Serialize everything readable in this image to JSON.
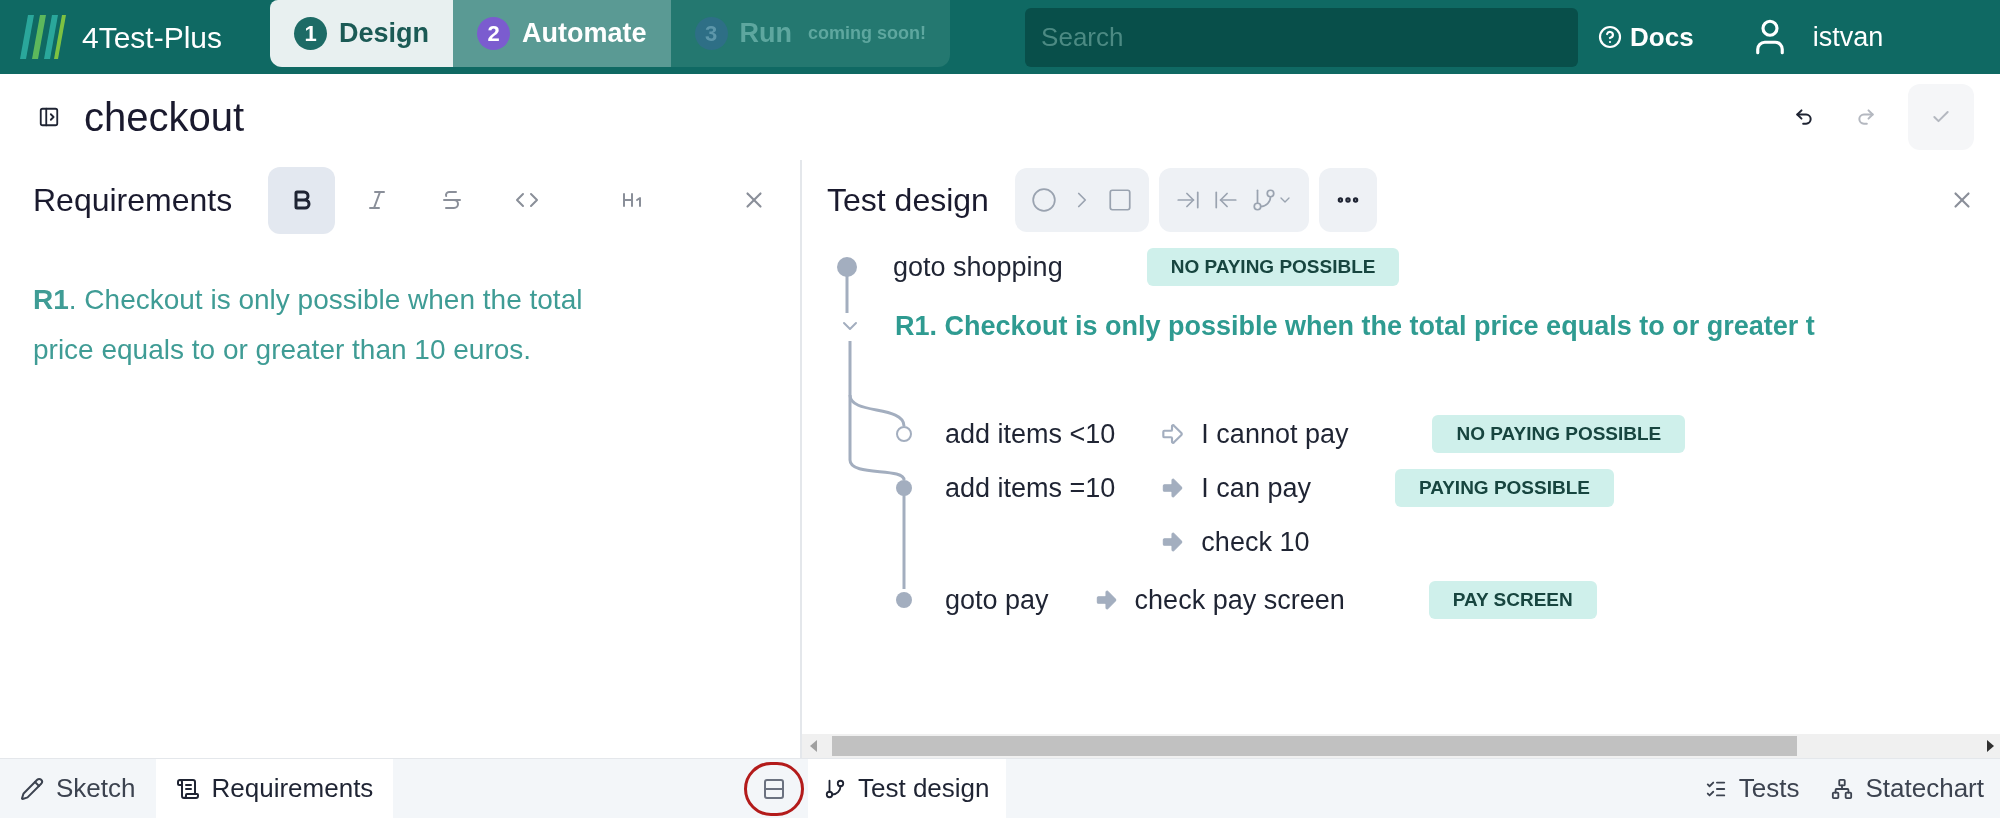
{
  "app": {
    "name": "4Test-Plus"
  },
  "stages": [
    {
      "number": "1",
      "label": "Design",
      "selected": true,
      "disabled": false
    },
    {
      "number": "2",
      "label": "Automate",
      "selected": false,
      "disabled": false
    },
    {
      "number": "3",
      "label": "Run",
      "note": "coming soon!",
      "selected": false,
      "disabled": true
    }
  ],
  "search": {
    "placeholder": "Search"
  },
  "docs_link": "Docs",
  "user": {
    "name": "istvan"
  },
  "page": {
    "title": "checkout"
  },
  "page_actions": [
    {
      "kind": "undo",
      "disabled": false
    },
    {
      "kind": "redo",
      "disabled": true
    },
    {
      "kind": "save",
      "disabled": true
    }
  ],
  "requirements_panel": {
    "title": "Requirements",
    "format_buttons": [
      {
        "kind": "bold",
        "selected": true
      },
      {
        "kind": "italic",
        "selected": false
      },
      {
        "kind": "strike",
        "selected": false
      },
      {
        "kind": "code",
        "selected": false
      },
      {
        "kind": "heading",
        "selected": false
      }
    ],
    "text": "**R1**. Checkout is only possible when the total price equals to or greater than 10 euros."
  },
  "test_design_panel": {
    "title": "Test design",
    "tree": [
      {
        "kind": "step",
        "label": "goto shopping",
        "reached": true,
        "badge": "NO PAYING POSSIBLE"
      },
      {
        "kind": "requirement",
        "text": "R1. Checkout is only possible when the total price equals to or greater t",
        "expanded": true,
        "children": [
          {
            "kind": "step",
            "label": "add items <10",
            "reached": false,
            "outcomes": [
              {
                "kind": "hollow",
                "text": "I cannot pay",
                "badge": "NO PAYING POSSIBLE"
              }
            ]
          },
          {
            "kind": "step",
            "label": "add items =10",
            "reached": true,
            "outcomes": [
              {
                "kind": "solid",
                "text": "I can pay",
                "badge": "PAYING POSSIBLE"
              },
              {
                "kind": "solid",
                "text": "check 10"
              }
            ]
          }
        ]
      },
      {
        "kind": "step",
        "label": "goto pay",
        "reached": true,
        "outcomes": [
          {
            "kind": "solid",
            "text": "check pay screen",
            "badge": "PAY SCREEN"
          }
        ]
      }
    ]
  },
  "bottom_left_tabs": [
    {
      "kind": "sketch",
      "label": "Sketch",
      "selected": false
    },
    {
      "kind": "requirements",
      "label": "Requirements",
      "selected": true
    }
  ],
  "bottom_right_tabs": [
    {
      "kind": "design",
      "label": "Test design",
      "selected": true
    },
    {
      "kind": "tests",
      "label": "Tests",
      "selected": false
    },
    {
      "kind": "statechart",
      "label": "Statechart",
      "selected": false
    }
  ]
}
